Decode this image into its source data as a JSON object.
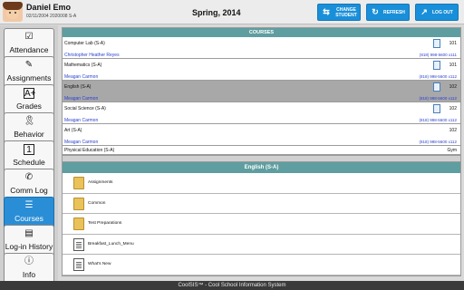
{
  "header": {
    "student_name": "Daniel Emo",
    "student_meta": "02/11/2004 2020008 S-A",
    "term": "Spring, 2014",
    "buttons": {
      "change_student": "CHANGE STUDENT",
      "refresh": "REFRESH",
      "logout": "LOG OUT"
    }
  },
  "sidebar": {
    "items": [
      {
        "label": "Attendance"
      },
      {
        "label": "Assignments"
      },
      {
        "label": "Grades"
      },
      {
        "label": "Behavior"
      },
      {
        "label": "Schedule"
      },
      {
        "label": "Comm Log"
      },
      {
        "label": "Courses",
        "active": true
      },
      {
        "label": "Log-in History"
      },
      {
        "label": "Info"
      }
    ],
    "grades_icon_text": "A+",
    "schedule_icon_text": "1"
  },
  "courses_panel": {
    "title": "COURSES",
    "courses": [
      {
        "name": "Computer Lab (S-A)",
        "room": "101",
        "teacher": "Christopher Heather Reyes",
        "phone": "(818) 998-5600 x111"
      },
      {
        "name": "Mathematics (S-A)",
        "room": "101",
        "teacher": "Meagan Carmon",
        "phone": "(818) 998-5600 x112"
      },
      {
        "name": "English (S-A)",
        "room": "102",
        "teacher": "Meagan Carmon",
        "phone": "(818) 998-5600 x112"
      },
      {
        "name": "Social Science (S-A)",
        "room": "102",
        "teacher": "Meagan Carmon",
        "phone": "(818) 998-5600 x112"
      },
      {
        "name": "Art (S-A)",
        "room": "102",
        "teacher": "Meagan Carmon",
        "phone": "(818) 998-5600 x112"
      },
      {
        "name": "Physical Education (S-A)",
        "room": "Gym"
      }
    ]
  },
  "folder_panel": {
    "title": "English (S-A)",
    "items": [
      {
        "name": "Assignments",
        "type": "folder"
      },
      {
        "name": "Common",
        "type": "folder"
      },
      {
        "name": "Test Preparations",
        "type": "folder"
      },
      {
        "name": "Breakfast_Lunch_Menu",
        "type": "file"
      },
      {
        "name": "What's New",
        "type": "file"
      }
    ]
  },
  "footer": {
    "text": "CoolSIS™ - Cool School Information System"
  },
  "colors": {
    "accent_blue": "#2a8ed6",
    "panel_header": "#5f9ea0",
    "link_blue": "#2a3fd1"
  }
}
